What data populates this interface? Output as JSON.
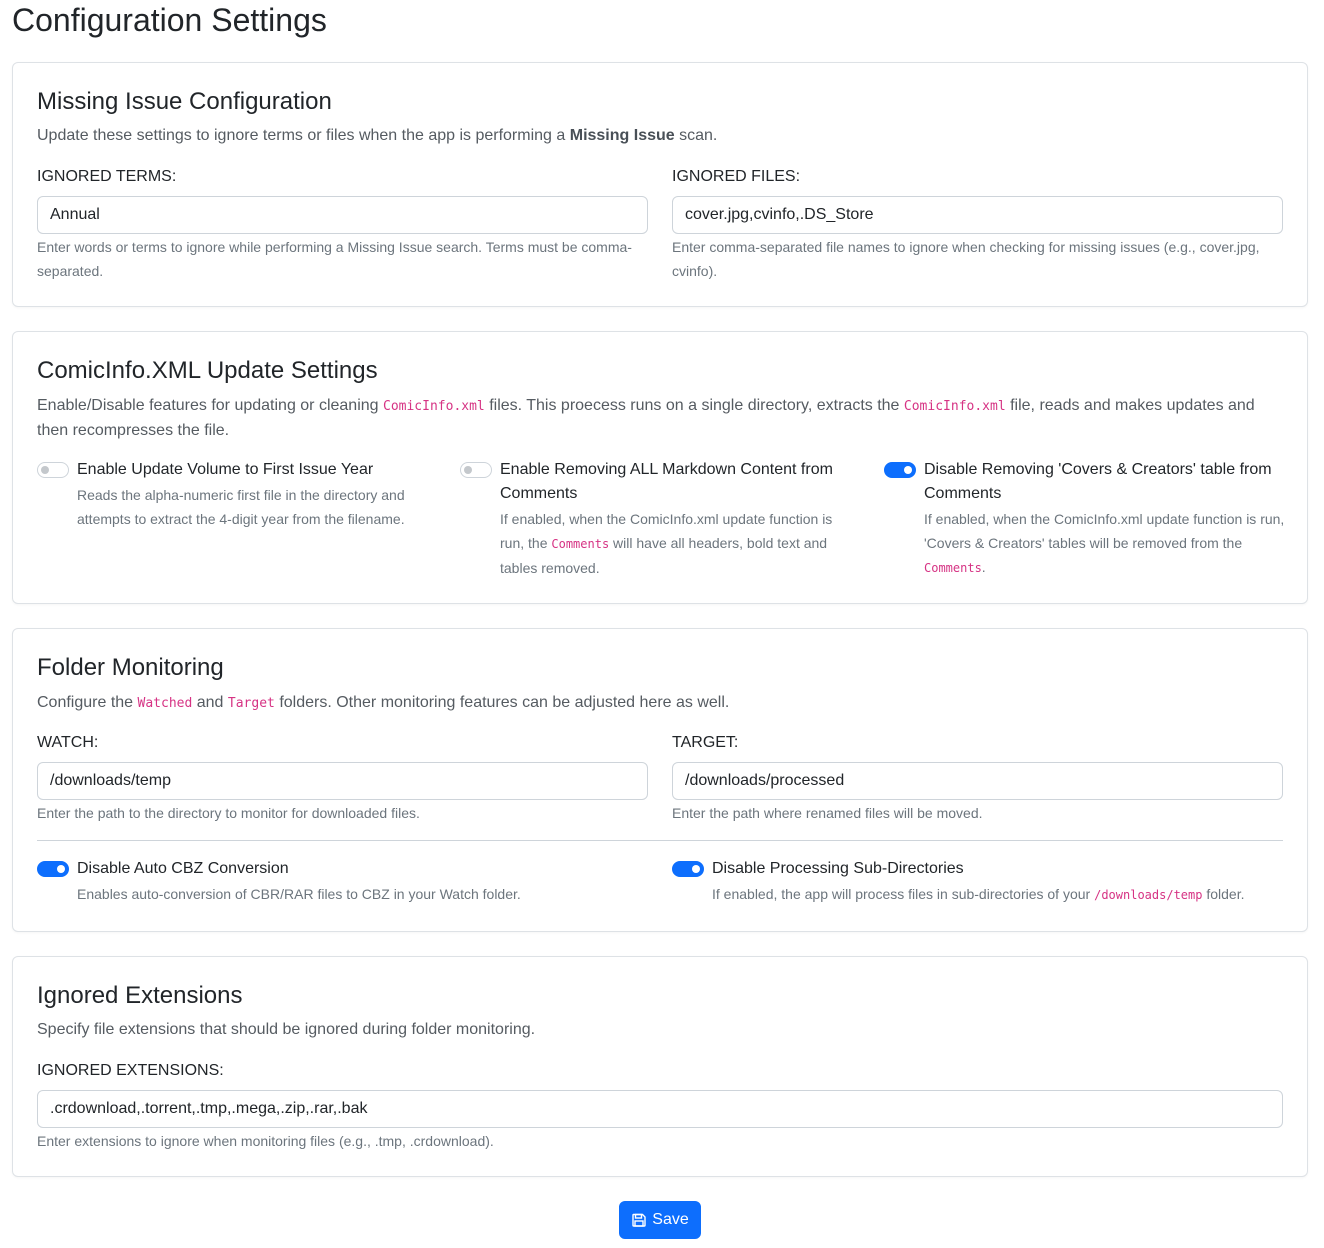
{
  "page": {
    "title": "Configuration Settings"
  },
  "missing_issue": {
    "title": "Missing Issue Configuration",
    "desc_before": "Update these settings to ignore terms or files when the app is performing a ",
    "desc_bold": "Missing Issue",
    "desc_after": " scan.",
    "ignored_terms": {
      "label": "IGNORED TERMS:",
      "value": "Annual",
      "help": "Enter words or terms to ignore while performing a Missing Issue search. Terms must be comma-separated."
    },
    "ignored_files": {
      "label": "IGNORED FILES:",
      "value": "cover.jpg,cvinfo,.DS_Store",
      "help": "Enter comma-separated file names to ignore when checking for missing issues (e.g., cover.jpg, cvinfo)."
    }
  },
  "comicinfo": {
    "title": "ComicInfo.XML Update Settings",
    "desc_1": "Enable/Disable features for updating or cleaning ",
    "desc_code_1": "ComicInfo.xml",
    "desc_2": " files. This proecess runs on a single directory, extracts the ",
    "desc_code_2": "ComicInfo.xml",
    "desc_3": " file, reads and makes updates and then recompresses the file.",
    "options": [
      {
        "enabled": false,
        "label": "Enable Update Volume to First Issue Year",
        "help": "Reads the alpha-numeric first file in the directory and attempts to extract the 4-digit year from the filename."
      },
      {
        "enabled": false,
        "label": "Enable Removing ALL Markdown Content from Comments",
        "help_1": "If enabled, when the ComicInfo.xml update function is run, the ",
        "help_code": "Comments",
        "help_2": " will have all headers, bold text and tables removed."
      },
      {
        "enabled": true,
        "label": "Disable Removing 'Covers & Creators' table from Comments",
        "help_1": "If enabled, when the ComicInfo.xml update function is run, 'Covers & Creators' tables will be removed from the ",
        "help_code": "Comments",
        "help_2": "."
      }
    ]
  },
  "folder_monitoring": {
    "title": "Folder Monitoring",
    "desc_1": "Configure the ",
    "desc_code_1": "Watched",
    "desc_2": " and ",
    "desc_code_2": "Target",
    "desc_3": " folders. Other monitoring features can be adjusted here as well.",
    "watch": {
      "label": "WATCH:",
      "value": "/downloads/temp",
      "help": "Enter the path to the directory to monitor for downloaded files."
    },
    "target": {
      "label": "TARGET:",
      "value": "/downloads/processed",
      "help": "Enter the path where renamed files will be moved."
    },
    "auto_cbz": {
      "enabled": true,
      "label": "Disable Auto CBZ Conversion",
      "help": "Enables auto-conversion of CBR/RAR files to CBZ in your Watch folder."
    },
    "subdirs": {
      "enabled": true,
      "label": "Disable Processing Sub-Directories",
      "help_1": "If enabled, the app will process files in sub-directories of your ",
      "help_code": "/downloads/temp",
      "help_2": " folder."
    }
  },
  "ignored_extensions": {
    "title": "Ignored Extensions",
    "desc": "Specify file extensions that should be ignored during folder monitoring.",
    "label": "IGNORED EXTENSIONS:",
    "value": ".crdownload,.torrent,.tmp,.mega,.zip,.rar,.bak",
    "help": "Enter extensions to ignore when monitoring files (e.g., .tmp, .crdownload)."
  },
  "actions": {
    "save_label": "Save",
    "save_icon": "floppy-disk-icon"
  },
  "colors": {
    "primary": "#0d6efd",
    "code": "#d63384",
    "muted": "#6c757d",
    "border": "#dee2e6"
  }
}
